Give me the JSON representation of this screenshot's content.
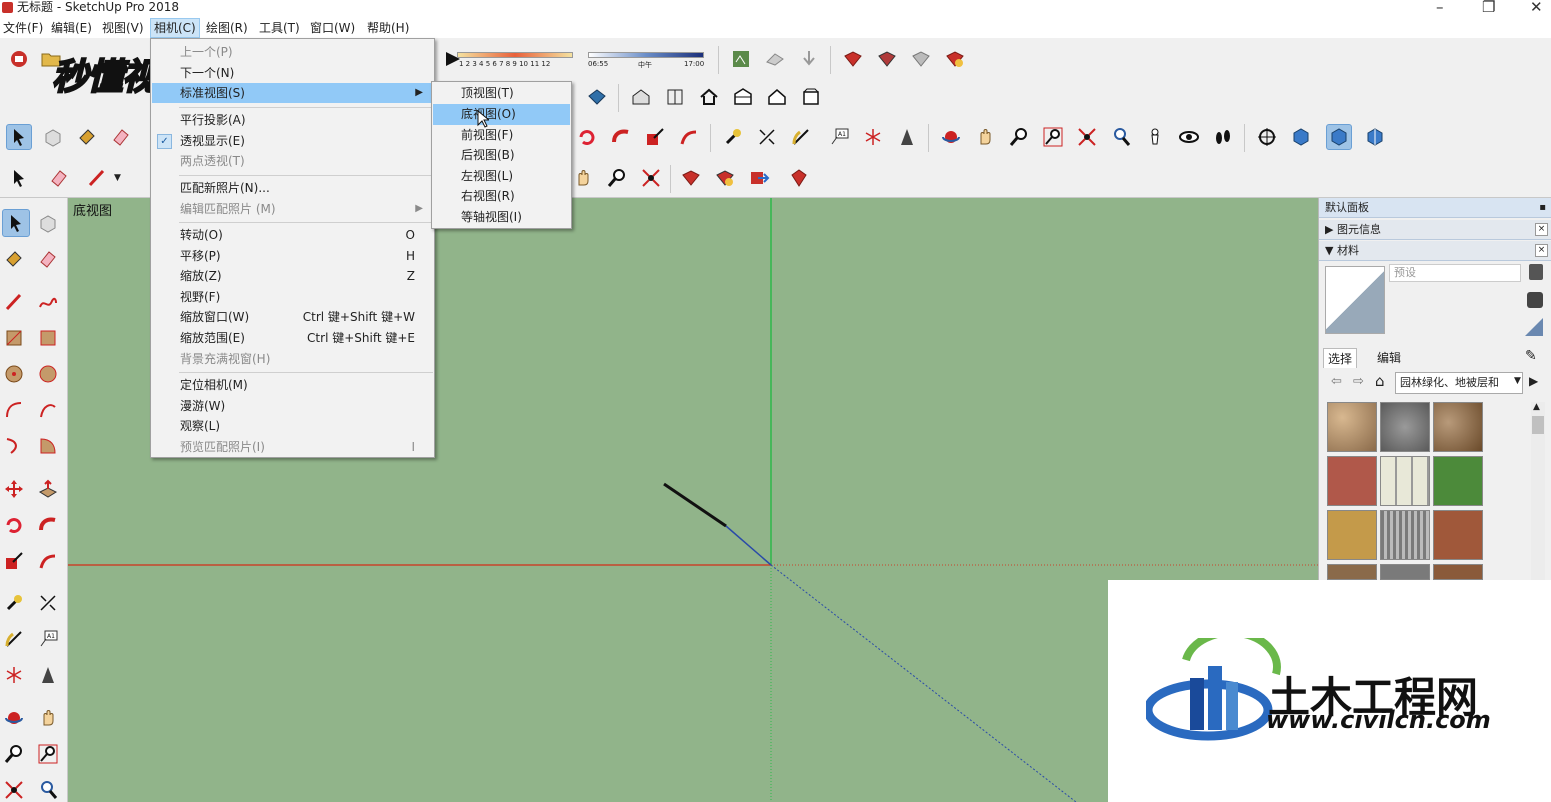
{
  "window": {
    "title": "无标题 - SketchUp Pro 2018",
    "minimize": "–",
    "maximize": "❐",
    "close": "✕"
  },
  "menubar": [
    {
      "label": "文件(F)"
    },
    {
      "label": "编辑(E)"
    },
    {
      "label": "视图(V)"
    },
    {
      "label": "相机(C)",
      "active": true
    },
    {
      "label": "绘图(R)"
    },
    {
      "label": "工具(T)"
    },
    {
      "label": "窗口(W)"
    },
    {
      "label": "帮助(H)"
    }
  ],
  "camera_menu": {
    "items": [
      {
        "label": "上一个(P)",
        "disabled": true
      },
      {
        "label": "下一个(N)"
      },
      {
        "label": "标准视图(S)",
        "submenu": true,
        "highlight": true
      },
      {
        "label": "平行投影(A)"
      },
      {
        "label": "透视显示(E)",
        "checked": true
      },
      {
        "label": "两点透视(T)",
        "disabled": true
      },
      {
        "label": "匹配新照片(N)..."
      },
      {
        "label": "编辑匹配照片 (M)",
        "disabled": true,
        "submenu": true
      },
      {
        "label": "转动(O)",
        "shortcut": "O"
      },
      {
        "label": "平移(P)",
        "shortcut": "H"
      },
      {
        "label": "缩放(Z)",
        "shortcut": "Z"
      },
      {
        "label": "视野(F)"
      },
      {
        "label": "缩放窗口(W)",
        "shortcut": "Ctrl 键+Shift 键+W"
      },
      {
        "label": "缩放范围(E)",
        "shortcut": "Ctrl 键+Shift 键+E"
      },
      {
        "label": "背景充满视窗(H)",
        "disabled": true
      },
      {
        "label": "定位相机(M)"
      },
      {
        "label": "漫游(W)"
      },
      {
        "label": "观察(L)"
      },
      {
        "label": "预览匹配照片(I)",
        "shortcut": "I",
        "disabled": true
      }
    ]
  },
  "standard_views_submenu": {
    "items": [
      {
        "label": "顶视图(T)"
      },
      {
        "label": "底视图(O)",
        "highlight": true
      },
      {
        "label": "前视图(F)"
      },
      {
        "label": "后视图(B)"
      },
      {
        "label": "左视图(L)"
      },
      {
        "label": "右视图(R)"
      },
      {
        "label": "等轴视图(I)"
      }
    ]
  },
  "shadow_toolbar": {
    "months": "1 2 3 4 5 6 7 8 9 10 11 12",
    "time_start": "06:55",
    "time_mid": "中午",
    "time_end": "17:00"
  },
  "viewport": {
    "view_label": "底视图",
    "background": "#91b48a"
  },
  "tray": {
    "title": "默认面板",
    "pin": "ᵖ",
    "entity_info": "▶ 图元信息",
    "materials": "▼ 材料",
    "preset_placeholder": "预设",
    "tab_select": "选择",
    "tab_edit": "编辑",
    "library": "园林绿化、地被层和",
    "close": "×"
  },
  "watermarks": {
    "video_brand": "秒懂视频",
    "logo_cn": "土木工程网",
    "logo_url": "www.civilcn.com"
  }
}
